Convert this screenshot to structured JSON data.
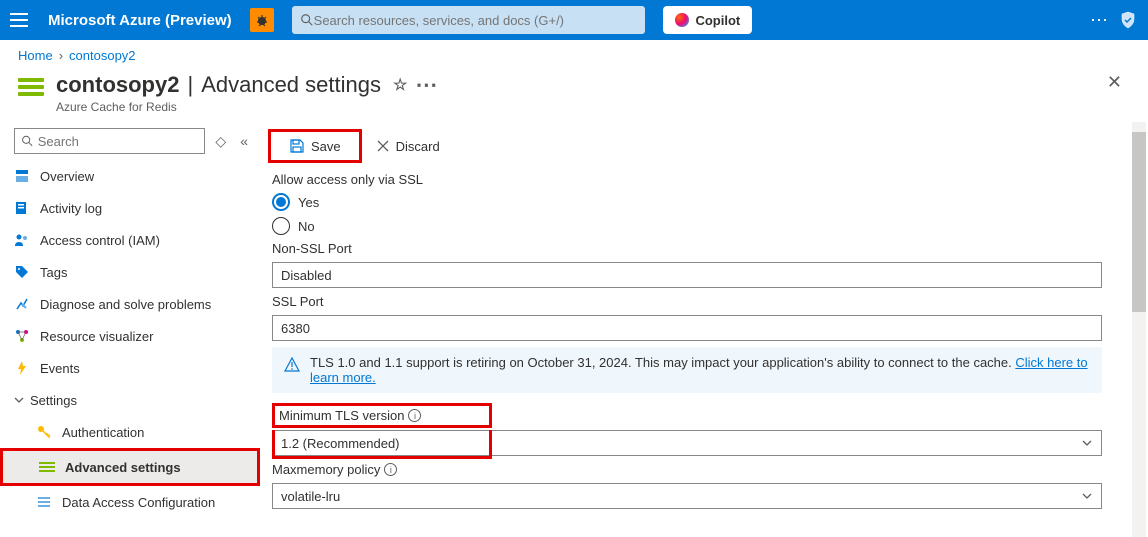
{
  "topbar": {
    "brand": "Microsoft Azure (Preview)",
    "search_placeholder": "Search resources, services, and docs (G+/)",
    "copilot_label": "Copilot"
  },
  "breadcrumb": {
    "home": "Home",
    "resource": "contosopy2"
  },
  "header": {
    "resource_name": "contosopy2",
    "page_title": "Advanced settings",
    "subtitle": "Azure Cache for Redis"
  },
  "nav": {
    "search_placeholder": "Search",
    "items": {
      "overview": "Overview",
      "activity_log": "Activity log",
      "access_control": "Access control (IAM)",
      "tags": "Tags",
      "diagnose": "Diagnose and solve problems",
      "resource_visualizer": "Resource visualizer",
      "events": "Events",
      "settings_group": "Settings",
      "authentication": "Authentication",
      "advanced_settings": "Advanced settings",
      "data_access": "Data Access Configuration"
    }
  },
  "toolbar": {
    "save": "Save",
    "discard": "Discard"
  },
  "form": {
    "ssl_access_label": "Allow access only via SSL",
    "yes": "Yes",
    "no": "No",
    "non_ssl_port_label": "Non-SSL Port",
    "non_ssl_port_value": "Disabled",
    "ssl_port_label": "SSL Port",
    "ssl_port_value": "6380",
    "tls_warning": "TLS 1.0 and 1.1 support is retiring on October 31, 2024. This may impact your application's ability to connect to the cache. ",
    "tls_warning_link": "Click here to learn more.",
    "min_tls_label": "Minimum TLS version",
    "min_tls_value": "1.2 (Recommended)",
    "maxmemory_label": "Maxmemory policy",
    "maxmemory_value": "volatile-lru"
  }
}
